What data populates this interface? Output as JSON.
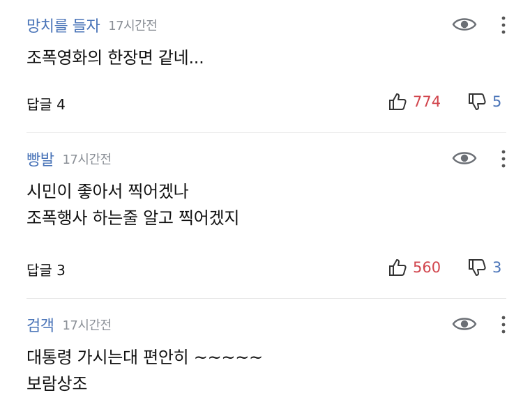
{
  "comments": [
    {
      "author": "망치를 들자",
      "time": "17시간전",
      "lines": [
        "조폭영화의 한장면 같네..."
      ],
      "reply_label": "답글 4",
      "likes": "774",
      "dislikes": "5"
    },
    {
      "author": "빵발",
      "time": "17시간전",
      "lines": [
        "시민이 좋아서 찍어겠나",
        "조폭행사 하는줄 알고 찍어겠지"
      ],
      "reply_label": "답글 3",
      "likes": "560",
      "dislikes": "3"
    },
    {
      "author": "검객",
      "time": "17시간전",
      "lines": [
        "대통령 가시는대 편안히 ~~~~~",
        "보람상조"
      ]
    }
  ],
  "icons": {
    "view": "eye-icon",
    "more": "more-vertical-icon",
    "like": "thumbs-up-icon",
    "dislike": "thumbs-down-icon"
  },
  "colors": {
    "author": "#4a74b8",
    "likes": "#d1454d",
    "dislikes": "#4a74b8",
    "timestamp": "#8a8f96",
    "divider": "#e8e8e8"
  }
}
